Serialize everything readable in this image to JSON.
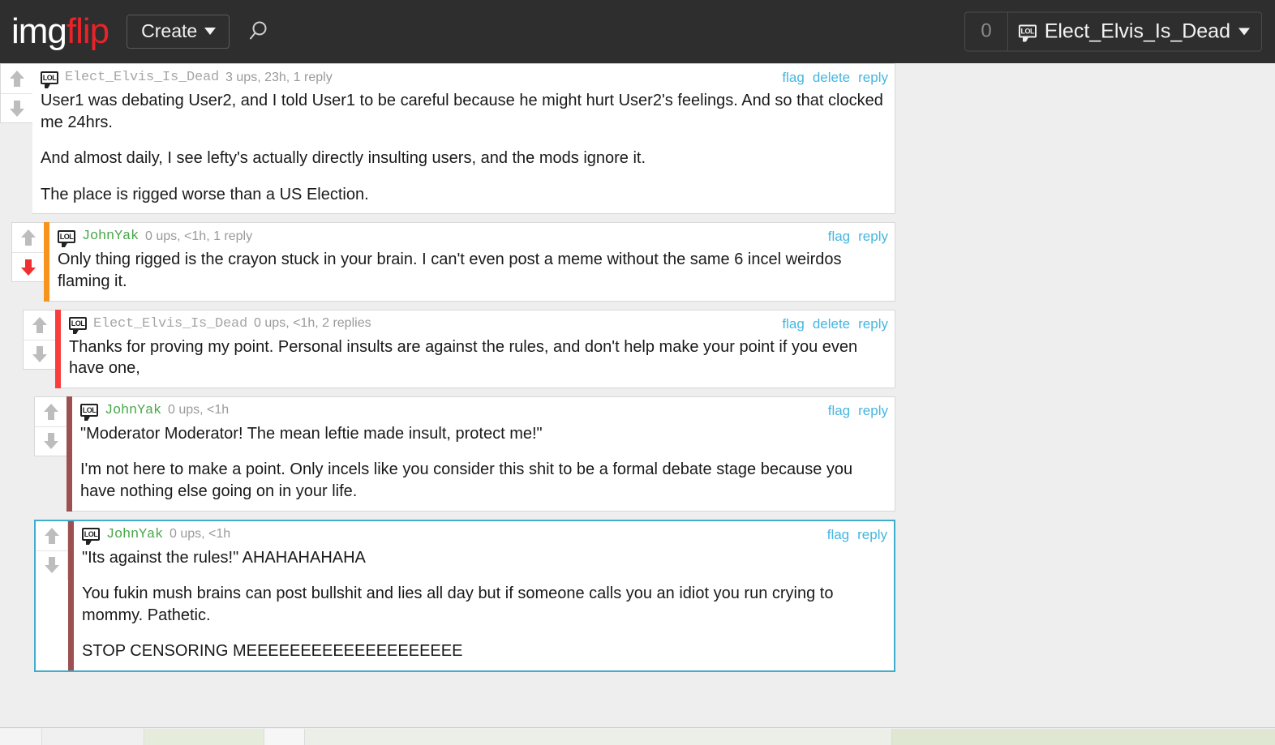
{
  "header": {
    "logo_img": "img",
    "logo_flip": "flip",
    "create_label": "Create",
    "caret_icon": "chevron-down-icon",
    "search_icon": "search-icon",
    "notification_count": "0",
    "user_badge_icon": "lol-badge-icon",
    "user_name": "Elect_Elvis_Is_Dead",
    "user_caret_icon": "chevron-down-icon"
  },
  "actions": {
    "flag": "flag",
    "delete": "delete",
    "reply": "reply"
  },
  "comments": [
    {
      "id": "c1",
      "author": "Elect_Elvis_Is_Dead",
      "author_color": "grey",
      "meta": "3 ups, 23h, 1 reply",
      "depth": 0,
      "accent_color": "",
      "upvoted": false,
      "downvoted": false,
      "highlighted": false,
      "has_delete": true,
      "paragraphs": [
        "User1 was debating User2, and I told User1 to be careful because he might hurt User2's feelings. And so that clocked me 24hrs.",
        "And almost daily, I see lefty's actually directly insulting users, and the mods ignore it.",
        "The place is rigged worse than a US Election."
      ]
    },
    {
      "id": "c2",
      "author": "JohnYak",
      "author_color": "green",
      "meta": "0 ups, <1h, 1 reply",
      "depth": 1,
      "accent_color": "#f7941e",
      "upvoted": false,
      "downvoted": true,
      "highlighted": false,
      "has_delete": false,
      "paragraphs": [
        "Only thing rigged is the crayon stuck in your brain. I can't even post a meme without the same 6 incel weirdos flaming it."
      ]
    },
    {
      "id": "c3",
      "author": "Elect_Elvis_Is_Dead",
      "author_color": "grey",
      "meta": "0 ups, <1h, 2 replies",
      "depth": 2,
      "accent_color": "#fa3c3c",
      "upvoted": false,
      "downvoted": false,
      "highlighted": false,
      "has_delete": true,
      "paragraphs": [
        "Thanks for proving my point. Personal insults are against the rules, and don't help make your point if you even have one,"
      ]
    },
    {
      "id": "c4",
      "author": "JohnYak",
      "author_color": "green",
      "meta": "0 ups, <1h",
      "depth": 3,
      "accent_color": "#9c5050",
      "upvoted": false,
      "downvoted": false,
      "highlighted": false,
      "has_delete": false,
      "paragraphs": [
        "\"Moderator Moderator! The mean leftie made insult, protect me!\"",
        "I'm not here to make a point. Only incels like you consider this shit to be a formal debate stage because you have nothing else going on in your life."
      ]
    },
    {
      "id": "c5",
      "author": "JohnYak",
      "author_color": "green",
      "meta": "0 ups, <1h",
      "depth": 3,
      "accent_color": "#9c5050",
      "upvoted": false,
      "downvoted": false,
      "highlighted": true,
      "has_delete": false,
      "paragraphs": [
        "\"Its against the rules!\" AHAHAHAHAHA",
        "You fukin mush brains can post bullshit and lies all day but if someone calls you an idiot you run crying to mommy. Pathetic.",
        "STOP CENSORING MEEEEEEEEEEEEEEEEEEEE"
      ]
    }
  ],
  "colors": {
    "link": "#45b6e0",
    "header_bg": "#2e2e2e",
    "logo_red": "#e8232a",
    "username_green": "#4aa84a",
    "downvote_active": "#f03030",
    "highlight_border": "#3fadcb"
  }
}
